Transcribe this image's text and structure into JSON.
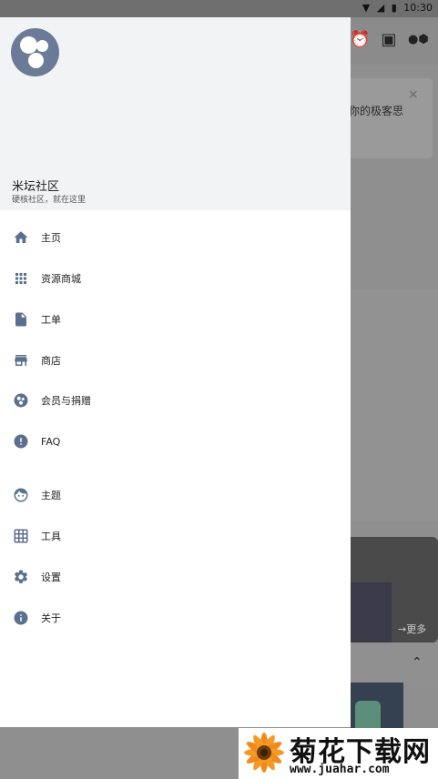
{
  "status_bar": {
    "time": "10:30"
  },
  "background": {
    "card_text": "你的极客思",
    "card_close": "×",
    "more_link": "→更多",
    "chevron": "⌃"
  },
  "drawer": {
    "header": {
      "title": "米坛社区",
      "subtitle": "硬核社区，就在这里"
    },
    "items": [
      {
        "label": "主页",
        "icon": "home-icon"
      },
      {
        "label": "资源商城",
        "icon": "apps-grid-icon"
      },
      {
        "label": "工单",
        "icon": "document-icon"
      },
      {
        "label": "商店",
        "icon": "store-icon"
      },
      {
        "label": "会员与捐赠",
        "icon": "membership-icon"
      },
      {
        "label": "FAQ",
        "icon": "info-alert-icon"
      },
      {
        "label": "主题",
        "icon": "face-icon"
      },
      {
        "label": "工具",
        "icon": "tools-grid-icon"
      },
      {
        "label": "设置",
        "icon": "gear-icon"
      },
      {
        "label": "关于",
        "icon": "info-icon"
      }
    ]
  },
  "watermark": {
    "title": "菊花下载网",
    "url": "www.juahar.com"
  },
  "colors": {
    "icon": "#5b6f8e",
    "header_bg": "#f2f3f5",
    "scrim": "#8f8f8f"
  }
}
